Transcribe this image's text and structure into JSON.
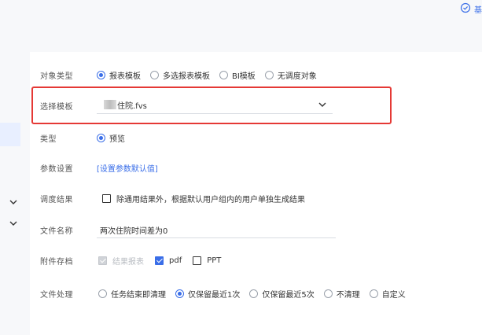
{
  "top_action": {
    "label": "基"
  },
  "form": {
    "object_type": {
      "label": "对象类型",
      "options": [
        "报表模板",
        "多选报表模板",
        "BI模板",
        "无调度对象"
      ],
      "selected": 0
    },
    "template": {
      "label": "选择模板",
      "value": "住院.fvs"
    },
    "type": {
      "label": "类型",
      "options": [
        "预览"
      ],
      "selected": 0
    },
    "params": {
      "label": "参数设置",
      "link": "[设置参数默认值]"
    },
    "schedule_result": {
      "label": "调度结果",
      "checkbox_text": "除通用结果外，根据默认用户组内的用户单独生成结果"
    },
    "file_name": {
      "label": "文件名称",
      "value": "两次住院时间差为0"
    },
    "attachment": {
      "label": "附件存档",
      "options": [
        {
          "text": "结果报表",
          "state": "disabled"
        },
        {
          "text": "pdf",
          "state": "checked"
        },
        {
          "text": "PPT",
          "state": "unchecked"
        }
      ]
    },
    "file_handling": {
      "label": "文件处理",
      "options": [
        "任务结束即清理",
        "仅保留最近1次",
        "仅保留最近5次",
        "不清理",
        "自定义"
      ],
      "selected": 1
    }
  },
  "colors": {
    "accent": "#3a6ee8",
    "highlight_border": "#e53935",
    "gutter": "#f7f8fa"
  },
  "icons": [
    "check-circle-icon",
    "chevron-down-icon"
  ]
}
